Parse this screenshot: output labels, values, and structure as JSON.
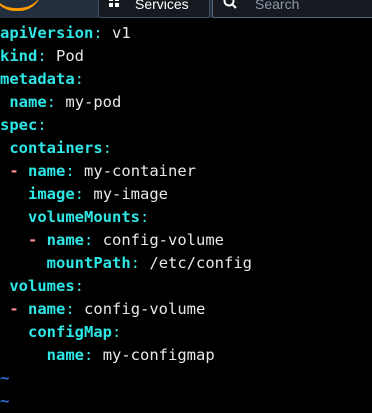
{
  "topbar": {
    "services_label": "Services",
    "search_placeholder": "Search"
  },
  "yaml": [
    {
      "indent": "",
      "dash": "",
      "key": "apiVersion",
      "value": "v1"
    },
    {
      "indent": "",
      "dash": "",
      "key": "kind",
      "value": "Pod"
    },
    {
      "indent": "",
      "dash": "",
      "key": "metadata",
      "value": ""
    },
    {
      "indent": " ",
      "dash": "",
      "key": "name",
      "value": "my-pod"
    },
    {
      "indent": "",
      "dash": "",
      "key": "spec",
      "value": ""
    },
    {
      "indent": " ",
      "dash": "",
      "key": "containers",
      "value": ""
    },
    {
      "indent": " ",
      "dash": "- ",
      "key": "name",
      "value": "my-container"
    },
    {
      "indent": "   ",
      "dash": "",
      "key": "image",
      "value": "my-image"
    },
    {
      "indent": "   ",
      "dash": "",
      "key": "volumeMounts",
      "value": ""
    },
    {
      "indent": "   ",
      "dash": "- ",
      "key": "name",
      "value": "config-volume"
    },
    {
      "indent": "     ",
      "dash": "",
      "key": "mountPath",
      "value": "/etc/config"
    },
    {
      "indent": " ",
      "dash": "",
      "key": "volumes",
      "value": ""
    },
    {
      "indent": " ",
      "dash": "- ",
      "key": "name",
      "value": "config-volume"
    },
    {
      "indent": "   ",
      "dash": "",
      "key": "configMap",
      "value": ""
    },
    {
      "indent": "     ",
      "dash": "",
      "key": "name",
      "value": "my-configmap"
    }
  ],
  "empty_line_marker": "~",
  "empty_line_count": 2,
  "colors": {
    "key": "#2ee6e6",
    "colon": "#3fe0e0",
    "value": "#e8e8e8",
    "dash": "#ff8c8c",
    "tilde": "#2a6fd6",
    "background": "#000000"
  }
}
